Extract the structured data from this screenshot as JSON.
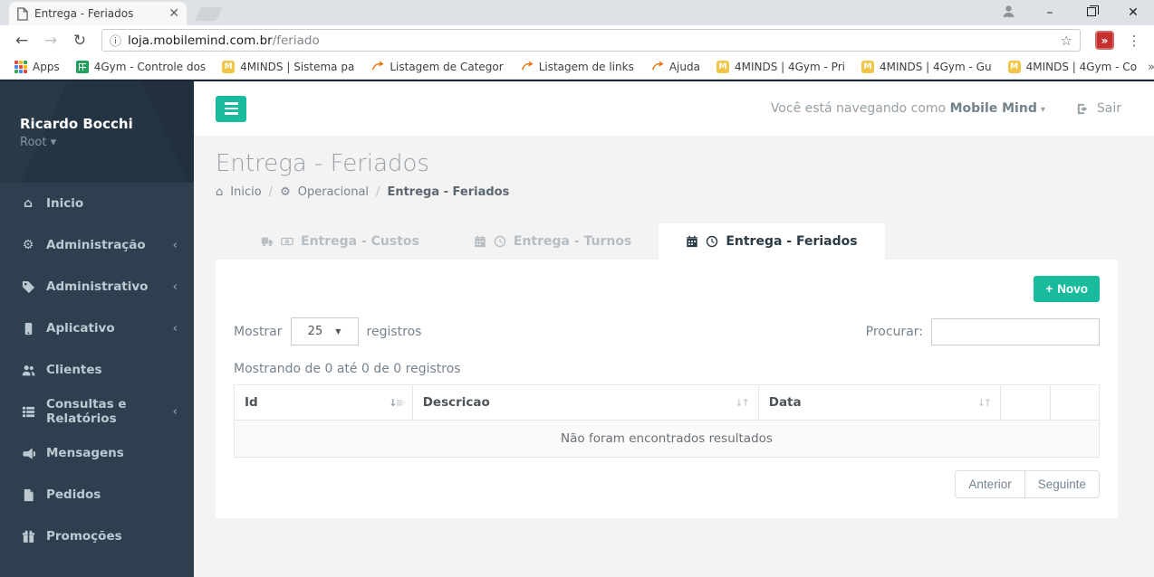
{
  "browser": {
    "tab_title": "Entrega - Feriados",
    "url": {
      "host": "loja.mobilemind.com.br",
      "path": "/feriado"
    },
    "glyphs": {
      "back": "←",
      "forward": "→",
      "reload": "↻",
      "info": "ⓘ",
      "star": "☆",
      "menu": "⋮",
      "tab_close": "✕",
      "minimize": "–",
      "window_close": "✕",
      "ext_badge": "»"
    },
    "bookmarks_bar": {
      "apps_label": "Apps",
      "items": [
        {
          "label": "4Gym - Controle dos",
          "icon": "sheet-icon"
        },
        {
          "label": "4MINDS | Sistema pa",
          "icon": "m-badge-icon"
        },
        {
          "label": "Listagem de Categor",
          "icon": "curved-arrow-icon"
        },
        {
          "label": "Listagem de links",
          "icon": "curved-arrow-icon"
        },
        {
          "label": "Ajuda",
          "icon": "curved-arrow-icon"
        },
        {
          "label": "4MINDS | 4Gym - Pri",
          "icon": "m-badge-icon"
        },
        {
          "label": "4MINDS | 4Gym - Gu",
          "icon": "m-badge-icon"
        },
        {
          "label": "4MINDS | 4Gym - Co",
          "icon": "m-badge-icon"
        }
      ],
      "overflow_glyph": "»"
    }
  },
  "sidebar": {
    "user": {
      "name": "Ricardo Bocchi",
      "role": "Root",
      "caret": "▾"
    },
    "chevron": "‹",
    "items": [
      {
        "label": "Inicio",
        "icon": "home-icon"
      },
      {
        "label": "Administração",
        "icon": "gears-icon"
      },
      {
        "label": "Administrativo",
        "icon": "tag-icon"
      },
      {
        "label": "Aplicativo",
        "icon": "mobile-icon"
      },
      {
        "label": "Clientes",
        "icon": "users-icon"
      },
      {
        "label": "Consultas e Relatórios",
        "icon": "list-icon"
      },
      {
        "label": "Mensagens",
        "icon": "bullhorn-icon"
      },
      {
        "label": "Pedidos",
        "icon": "file-icon"
      },
      {
        "label": "Promoções",
        "icon": "gift-icon"
      }
    ]
  },
  "topnav": {
    "navigating_as": "Você está navegando como",
    "user": "Mobile Mind",
    "caret": "▾",
    "signout": "Sair"
  },
  "page": {
    "title": "Entrega - Feriados",
    "breadcrumb": {
      "home": "Inicio",
      "separator": "/",
      "section": "Operacional",
      "current": "Entrega - Feriados"
    }
  },
  "tabs": [
    {
      "label": "Entrega - Custos",
      "icons": [
        "truck-icon",
        "money-icon"
      ]
    },
    {
      "label": "Entrega - Turnos",
      "icons": [
        "calendar-icon",
        "clock-icon"
      ]
    },
    {
      "label": "Entrega - Feriados",
      "icons": [
        "calendar-icon",
        "clock-icon"
      ],
      "active": true
    }
  ],
  "panel": {
    "new_button": {
      "plus": "+",
      "label": "Novo"
    },
    "length_control": {
      "show": "Mostrar",
      "page_size": "25",
      "select_caret": "▼",
      "registros": "registros"
    },
    "search": {
      "label": "Procurar:",
      "value": ""
    },
    "info": "Mostrando de 0 até 0 de 0 registros",
    "table": {
      "columns": [
        {
          "label": "Id"
        },
        {
          "label": "Descricao"
        },
        {
          "label": "Data"
        }
      ],
      "sort_glyphs": {
        "down": "↓",
        "up": "↑",
        "bars": "≡"
      },
      "empty_message": "Não foram encontrados resultados"
    },
    "pagination": {
      "prev": "Anterior",
      "next": "Seguinte"
    }
  },
  "colors": {
    "accent": "#18bc9c",
    "sidebar_bg": "#2e4050",
    "sidebar_profile_bg": "#243442",
    "ext_red": "#c5312e",
    "badge_yellow": "#f0c649",
    "sheet_green": "#1fa15d",
    "arrow_orange": "#e8710a"
  }
}
